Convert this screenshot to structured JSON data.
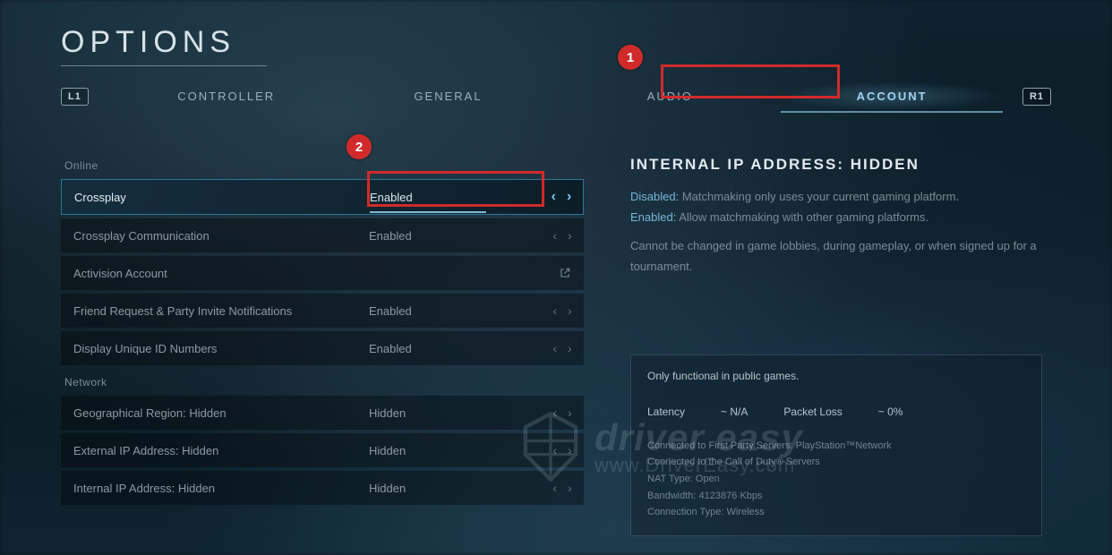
{
  "title": "OPTIONS",
  "bumper_left": "L1",
  "bumper_right": "R1",
  "tabs": [
    {
      "label": "CONTROLLER",
      "active": false
    },
    {
      "label": "GENERAL",
      "active": false
    },
    {
      "label": "AUDIO",
      "active": false
    },
    {
      "label": "ACCOUNT",
      "active": true
    }
  ],
  "sections": {
    "online": {
      "label": "Online",
      "rows": [
        {
          "label": "Crossplay",
          "value": "Enabled",
          "selected": true,
          "arrows": true
        },
        {
          "label": "Crossplay Communication",
          "value": "Enabled",
          "arrows": true
        },
        {
          "label": "Activision Account",
          "value": "",
          "external": true
        },
        {
          "label": "Friend Request & Party Invite Notifications",
          "value": "Enabled",
          "arrows": true
        },
        {
          "label": "Display Unique ID Numbers",
          "value": "Enabled",
          "arrows": true
        }
      ]
    },
    "network": {
      "label": "Network",
      "rows": [
        {
          "label": "Geographical Region: Hidden",
          "value": "Hidden",
          "arrows": true
        },
        {
          "label": "External IP Address: Hidden",
          "value": "Hidden",
          "arrows": true
        },
        {
          "label": "Internal IP Address: Hidden",
          "value": "Hidden",
          "arrows": true
        }
      ]
    }
  },
  "detail": {
    "heading": "INTERNAL IP ADDRESS: HIDDEN",
    "disabled_kw": "Disabled:",
    "disabled_text": " Matchmaking only uses your current gaming platform.",
    "enabled_kw": "Enabled:",
    "enabled_text": " Allow matchmaking with other gaming platforms.",
    "note": "Cannot be changed in game lobbies, during gameplay, or when signed up for a tournament."
  },
  "infobox": {
    "note": "Only functional in public games.",
    "latency_label": "Latency",
    "latency_value": "~ N/A",
    "packet_label": "Packet Loss",
    "packet_value": "~ 0%",
    "lines": [
      "Connected to First Party Servers: PlayStation™Network",
      "Connected to the Call of Duty® Servers",
      "NAT Type: Open",
      "Bandwidth: 4123876 Kbps",
      "Connection Type: Wireless"
    ]
  },
  "annotations": {
    "one": "1",
    "two": "2"
  },
  "watermark": {
    "line1": "driver easy",
    "line2": "www.DriverEasy.com"
  }
}
